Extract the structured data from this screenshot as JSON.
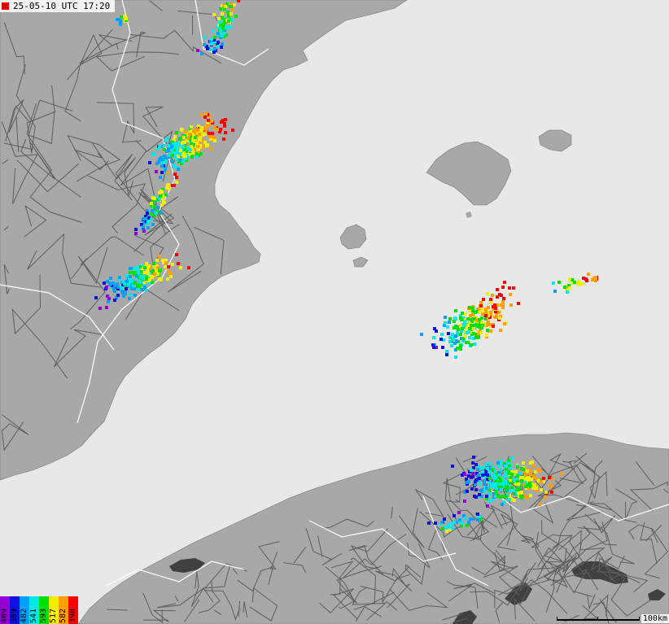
{
  "timestamp": "25-05-10 UTC 17:20",
  "scale_label": "100km",
  "legend": [
    {
      "label": "409",
      "color": "#9400d3"
    },
    {
      "label": "389",
      "color": "#1010e0"
    },
    {
      "label": "482",
      "color": "#00a0ff"
    },
    {
      "label": "541",
      "color": "#00e8e8"
    },
    {
      "label": "593",
      "color": "#00e000"
    },
    {
      "label": "517",
      "color": "#f0f000"
    },
    {
      "label": "582",
      "color": "#ffa000"
    },
    {
      "label": "398",
      "color": "#ff0000"
    }
  ],
  "colors": {
    "sea": "#e8e8e8",
    "land": "#a8a8a8",
    "roads": "#5e5e5e",
    "borders": "#ffffff",
    "lakes": "#404040"
  }
}
